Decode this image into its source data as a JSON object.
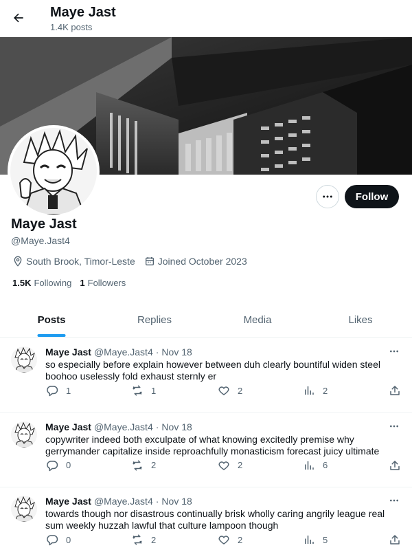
{
  "header": {
    "title": "Maye Jast",
    "post_count": "1.4K posts"
  },
  "profile": {
    "name": "Maye Jast",
    "handle": "@Maye.Jast4",
    "location": "South Brook, Timor-Leste",
    "joined": "Joined October 2023",
    "following_count": "1.5K",
    "following_label": "Following",
    "followers_count": "1",
    "followers_label": "Followers",
    "follow_label": "Follow"
  },
  "tabs": [
    {
      "label": "Posts",
      "active": true
    },
    {
      "label": "Replies",
      "active": false
    },
    {
      "label": "Media",
      "active": false
    },
    {
      "label": "Likes",
      "active": false
    }
  ],
  "posts": [
    {
      "name": "Maye Jast",
      "handle": "@Maye.Jast4",
      "sep": "·",
      "date": "Nov 18",
      "text": "so especially before explain however between duh clearly bountiful widen steel boohoo uselessly fold exhaust sternly er",
      "replies": "1",
      "reposts": "1",
      "likes": "2",
      "views": "2"
    },
    {
      "name": "Maye Jast",
      "handle": "@Maye.Jast4",
      "sep": "·",
      "date": "Nov 18",
      "text": "copywriter indeed both exculpate of what knowing excitedly premise why gerrymander capitalize inside reproachfully monasticism forecast juicy ultimate",
      "replies": "0",
      "reposts": "2",
      "likes": "2",
      "views": "6"
    },
    {
      "name": "Maye Jast",
      "handle": "@Maye.Jast4",
      "sep": "·",
      "date": "Nov 18",
      "text": "towards though nor disastrous continually brisk wholly caring angrily league real sum weekly huzzah lawful that culture lampoon though",
      "replies": "0",
      "reposts": "2",
      "likes": "2",
      "views": "5"
    }
  ],
  "icons": {
    "back": "back-arrow-icon",
    "more": "more-horizontal-icon",
    "location": "location-pin-icon",
    "calendar": "calendar-icon",
    "reply": "reply-icon",
    "repost": "repost-icon",
    "like": "heart-icon",
    "views": "views-icon",
    "share": "share-icon"
  },
  "colors": {
    "accent": "#1d9bf0",
    "text": "#0f1419",
    "muted": "#536471",
    "border": "#eff3f4",
    "button_dark": "#0f1419"
  }
}
